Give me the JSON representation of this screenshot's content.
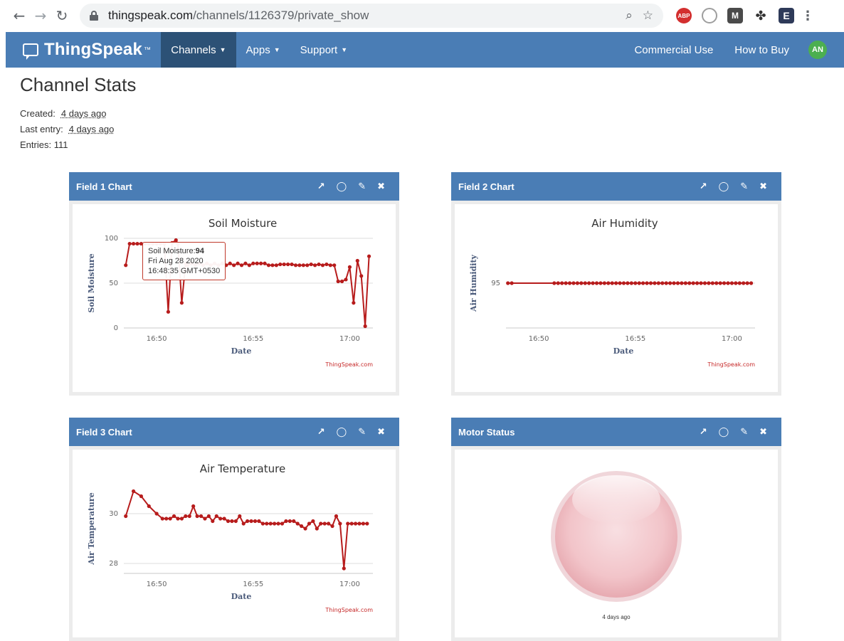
{
  "browser": {
    "url_host": "thingspeak.com",
    "url_path": "/channels/1126379/private_show",
    "ext_abp": "ABP",
    "ext_m": "M",
    "ext_e": "E"
  },
  "nav": {
    "logo": "ThingSpeak",
    "logo_tm": "™",
    "menu": [
      {
        "label": "Channels"
      },
      {
        "label": "Apps"
      },
      {
        "label": "Support"
      }
    ],
    "right": [
      {
        "label": "Commercial Use"
      },
      {
        "label": "How to Buy"
      }
    ],
    "avatar": "AN"
  },
  "stats": {
    "title": "Channel Stats",
    "created_label": "Created:",
    "created_value": "4 days ago",
    "last_entry_label": "Last entry:",
    "last_entry_value": "4 days ago",
    "entries_label": "Entries:",
    "entries_value": "111"
  },
  "panels": [
    {
      "title": "Field 1 Chart"
    },
    {
      "title": "Field 2 Chart"
    },
    {
      "title": "Field 3 Chart"
    },
    {
      "title": "Motor Status"
    }
  ],
  "credit": "ThingSpeak.com",
  "tooltip": {
    "series_label": "Soil Moisture:",
    "value": "94",
    "date": "Fri Aug 28 2020",
    "time": "16:48:35 GMT+0530"
  },
  "lamp": {
    "caption": "4 days ago",
    "color": "#f2c4c9"
  },
  "chart_data": [
    {
      "type": "line",
      "title": "Soil Moisture",
      "xlabel": "Date",
      "ylabel": "Soil Moisture",
      "x_ticks": [
        "16:50",
        "16:55",
        "17:00"
      ],
      "x_tick_minutes": [
        50,
        55,
        60
      ],
      "xlim": [
        48.3,
        61.2
      ],
      "y_ticks": [
        0,
        50,
        100
      ],
      "ylim": [
        0,
        100
      ],
      "color": "#b71c1c",
      "grid": true,
      "x": [
        48.4,
        48.6,
        48.8,
        49.0,
        49.2,
        49.4,
        49.6,
        49.8,
        50.0,
        50.2,
        50.4,
        50.6,
        50.8,
        51.0,
        51.1,
        51.3,
        51.5,
        51.6,
        51.8,
        52.0,
        52.2,
        52.4,
        52.6,
        52.8,
        53.0,
        53.2,
        53.4,
        53.6,
        53.8,
        54.0,
        54.2,
        54.4,
        54.6,
        54.8,
        55.0,
        55.2,
        55.4,
        55.6,
        55.8,
        56.0,
        56.2,
        56.4,
        56.6,
        56.8,
        57.0,
        57.2,
        57.4,
        57.6,
        57.8,
        58.0,
        58.2,
        58.4,
        58.6,
        58.8,
        59.0,
        59.2,
        59.4,
        59.6,
        59.8,
        60.0,
        60.2,
        60.4,
        60.6,
        60.8,
        61.0
      ],
      "y": [
        70,
        94,
        94,
        94,
        94,
        94,
        94,
        94,
        94,
        94,
        94,
        18,
        95,
        98,
        94,
        28,
        72,
        70,
        72,
        70,
        72,
        70,
        72,
        70,
        72,
        70,
        72,
        70,
        72,
        70,
        72,
        70,
        72,
        70,
        72,
        72,
        72,
        72,
        70,
        70,
        70,
        71,
        71,
        71,
        71,
        70,
        70,
        70,
        70,
        71,
        70,
        71,
        70,
        71,
        70,
        70,
        52,
        52,
        54,
        68,
        28,
        75,
        58,
        2,
        80
      ]
    },
    {
      "type": "line",
      "title": "Air Humidity",
      "xlabel": "Date",
      "ylabel": "Air Humidity",
      "x_ticks": [
        "16:50",
        "16:55",
        "17:00"
      ],
      "x_tick_minutes": [
        50,
        55,
        60
      ],
      "xlim": [
        48.3,
        61.2
      ],
      "y_ticks": [
        95
      ],
      "ylim": [
        90,
        100
      ],
      "color": "#b71c1c",
      "grid": true,
      "x": [
        48.4,
        48.6,
        50.8,
        51.0,
        51.2,
        51.4,
        51.6,
        51.8,
        52.0,
        52.2,
        52.4,
        52.6,
        52.8,
        53.0,
        53.2,
        53.4,
        53.6,
        53.8,
        54.0,
        54.2,
        54.4,
        54.6,
        54.8,
        55.0,
        55.2,
        55.4,
        55.6,
        55.8,
        56.0,
        56.2,
        56.4,
        56.6,
        56.8,
        57.0,
        57.2,
        57.4,
        57.6,
        57.8,
        58.0,
        58.2,
        58.4,
        58.6,
        58.8,
        59.0,
        59.2,
        59.4,
        59.6,
        59.8,
        60.0,
        60.2,
        60.4,
        60.6,
        60.8,
        61.0
      ],
      "y": [
        95,
        95,
        95,
        95,
        95,
        95,
        95,
        95,
        95,
        95,
        95,
        95,
        95,
        95,
        95,
        95,
        95,
        95,
        95,
        95,
        95,
        95,
        95,
        95,
        95,
        95,
        95,
        95,
        95,
        95,
        95,
        95,
        95,
        95,
        95,
        95,
        95,
        95,
        95,
        95,
        95,
        95,
        95,
        95,
        95,
        95,
        95,
        95,
        95,
        95,
        95,
        95,
        95,
        95
      ]
    },
    {
      "type": "line",
      "title": "Air Temperature",
      "xlabel": "Date",
      "ylabel": "Air Temperature",
      "x_ticks": [
        "16:50",
        "16:55",
        "17:00"
      ],
      "x_tick_minutes": [
        50,
        55,
        60
      ],
      "xlim": [
        48.3,
        61.2
      ],
      "y_ticks": [
        28,
        30
      ],
      "ylim": [
        27.6,
        31.2
      ],
      "color": "#b71c1c",
      "grid": true,
      "x": [
        48.4,
        48.8,
        49.2,
        49.6,
        50.0,
        50.3,
        50.5,
        50.7,
        50.9,
        51.1,
        51.3,
        51.5,
        51.7,
        51.9,
        52.1,
        52.3,
        52.5,
        52.7,
        52.9,
        53.1,
        53.3,
        53.5,
        53.7,
        53.9,
        54.1,
        54.3,
        54.5,
        54.7,
        54.9,
        55.1,
        55.3,
        55.5,
        55.7,
        55.9,
        56.1,
        56.3,
        56.5,
        56.7,
        56.9,
        57.1,
        57.3,
        57.5,
        57.7,
        57.9,
        58.1,
        58.3,
        58.5,
        58.7,
        58.9,
        59.1,
        59.3,
        59.5,
        59.7,
        59.9,
        60.1,
        60.3,
        60.5,
        60.7,
        60.9
      ],
      "y": [
        29.9,
        30.9,
        30.7,
        30.3,
        30.0,
        29.8,
        29.8,
        29.8,
        29.9,
        29.8,
        29.8,
        29.9,
        29.9,
        30.3,
        29.9,
        29.9,
        29.8,
        29.9,
        29.7,
        29.9,
        29.8,
        29.8,
        29.7,
        29.7,
        29.7,
        29.9,
        29.6,
        29.7,
        29.7,
        29.7,
        29.7,
        29.6,
        29.6,
        29.6,
        29.6,
        29.6,
        29.6,
        29.7,
        29.7,
        29.7,
        29.6,
        29.5,
        29.4,
        29.6,
        29.7,
        29.4,
        29.6,
        29.6,
        29.6,
        29.5,
        29.9,
        29.6,
        27.8,
        29.6,
        29.6,
        29.6,
        29.6,
        29.6,
        29.6
      ]
    }
  ]
}
